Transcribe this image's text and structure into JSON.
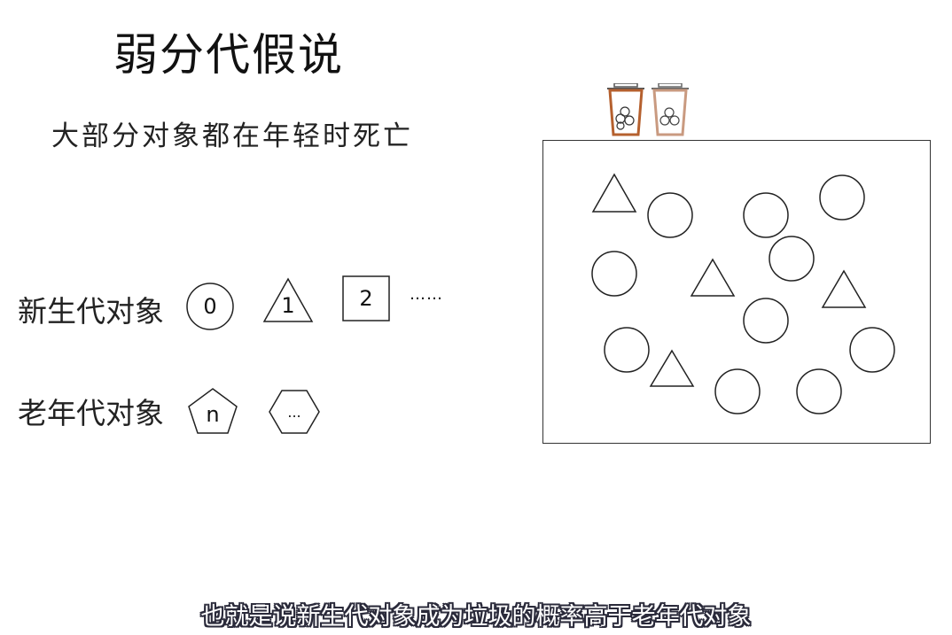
{
  "title": "弱分代假说",
  "subtitle": "大部分对象都在年轻时死亡",
  "young_gen": {
    "label": "新生代对象",
    "items": [
      {
        "shape": "circle",
        "text": "0"
      },
      {
        "shape": "triangle",
        "text": "1"
      },
      {
        "shape": "square",
        "text": "2"
      }
    ],
    "ellipsis": "……"
  },
  "old_gen": {
    "label": "老年代对象",
    "items": [
      {
        "shape": "pentagon",
        "text": "n"
      },
      {
        "shape": "hexagon",
        "text": "..."
      }
    ]
  },
  "heap": {
    "objects": [
      "triangle",
      "circle",
      "circle",
      "circle",
      "circle",
      "circle",
      "triangle",
      "triangle",
      "circle",
      "circle",
      "triangle",
      "circle",
      "circle",
      "circle"
    ]
  },
  "bins": {
    "count": 2,
    "colors": [
      "#b5602e",
      "#c99a80"
    ]
  },
  "caption": "也就是说新生代对象成为垃圾的概率高于老年代对象"
}
